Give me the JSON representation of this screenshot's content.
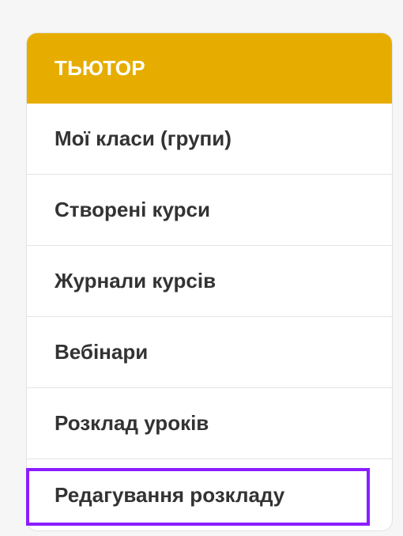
{
  "menu": {
    "title": "ТЬЮТОР",
    "items": [
      {
        "label": "Мої класи (групи)"
      },
      {
        "label": "Створені курси"
      },
      {
        "label": "Журнали курсів"
      },
      {
        "label": "Вебінари"
      },
      {
        "label": "Розклад уроків"
      },
      {
        "label": "Редагування розкладу"
      }
    ]
  },
  "colors": {
    "header_bg": "#e6ad00",
    "highlight_border": "#8b1dff",
    "item_text": "#333333"
  }
}
